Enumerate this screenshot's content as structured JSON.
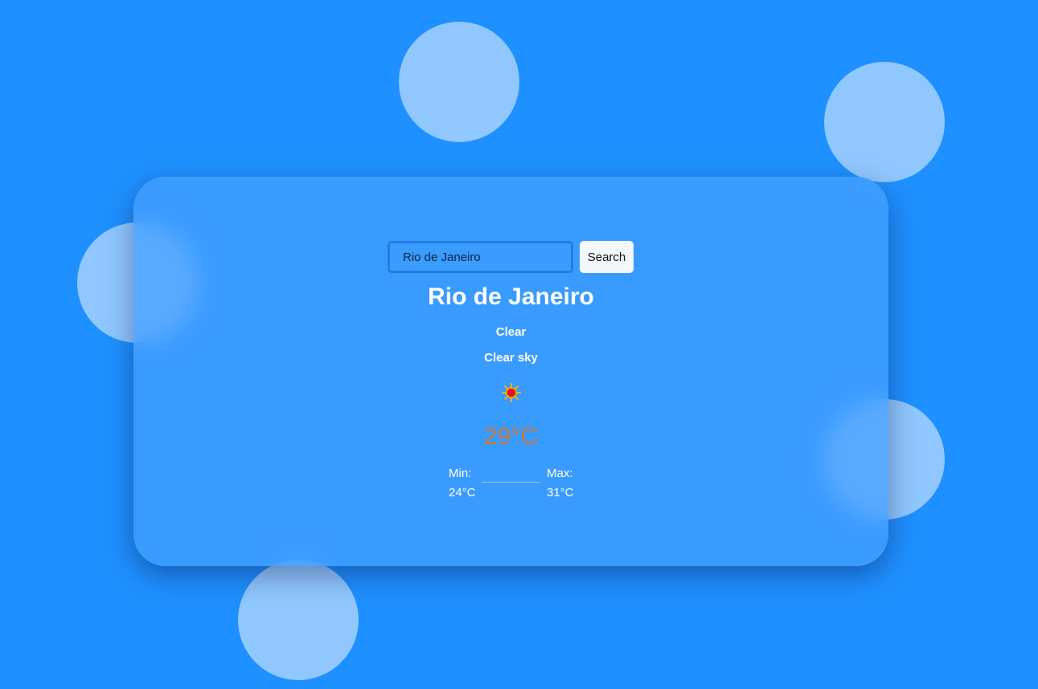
{
  "search": {
    "value": "Rio de Janeiro",
    "button_label": "Search"
  },
  "weather": {
    "city": "Rio de Janeiro",
    "main": "Clear",
    "description": "Clear sky",
    "icon": "sun-icon",
    "temperature": "29°C",
    "min_label": "Min:",
    "min_value": "24°C",
    "max_label": "Max:",
    "max_value": "31°C"
  },
  "colors": {
    "background": "#1f90ff",
    "bubble": "#90c7ff",
    "card": "#45a0ff",
    "temperature": "#c8763a"
  }
}
